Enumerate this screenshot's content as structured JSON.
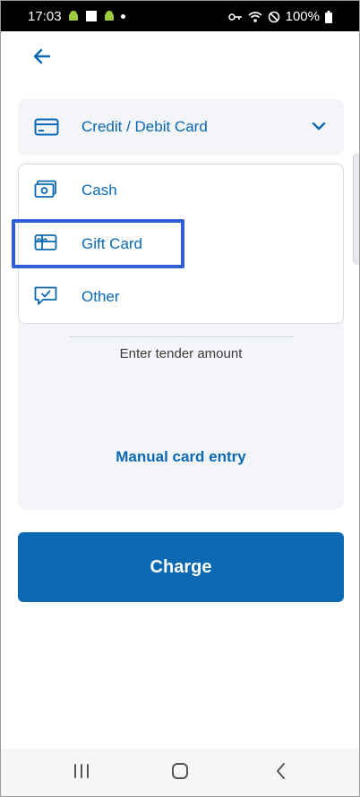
{
  "status": {
    "time": "17:03",
    "battery": "100%"
  },
  "payment": {
    "selected_method": "Credit / Debit Card",
    "options": [
      {
        "label": "Cash",
        "icon": "cash-icon"
      },
      {
        "label": "Gift Card",
        "icon": "gift-card-icon"
      },
      {
        "label": "Other",
        "icon": "chat-check-icon"
      }
    ],
    "tender_label": "Enter tender amount",
    "manual_entry": "Manual card entry",
    "charge_label": "Charge"
  },
  "colors": {
    "accent": "#0a69b2",
    "panel_bg": "#f3f5f9",
    "highlight": "#2f5fd6"
  }
}
